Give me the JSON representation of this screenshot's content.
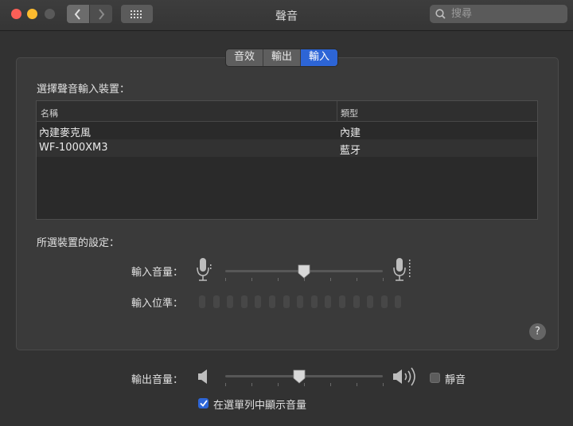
{
  "window": {
    "title": "聲音"
  },
  "search": {
    "placeholder": "搜尋"
  },
  "tabs": [
    {
      "label": "音效",
      "active": false
    },
    {
      "label": "輸出",
      "active": false
    },
    {
      "label": "輸入",
      "active": true
    }
  ],
  "input": {
    "section_label": "選擇聲音輸入裝置：",
    "columns": {
      "name": "名稱",
      "type": "類型"
    },
    "devices": [
      {
        "name": "內建麥克風",
        "type": "內建"
      },
      {
        "name": "WF-1000XM3",
        "type": "藍牙"
      }
    ],
    "settings_label": "所選裝置的設定：",
    "volume_label": "輸入音量：",
    "volume_level": 0.5,
    "level_label": "輸入位準：",
    "level_segments": 15
  },
  "output": {
    "volume_label": "輸出音量：",
    "volume_level": 0.47,
    "mute_label": "靜音",
    "mute_checked": false,
    "show_in_menubar_label": "在選單列中顯示音量",
    "show_in_menubar_checked": true
  },
  "help": {
    "label": "?"
  },
  "colors": {
    "accent": "#2d65d6",
    "background": "#323232"
  }
}
